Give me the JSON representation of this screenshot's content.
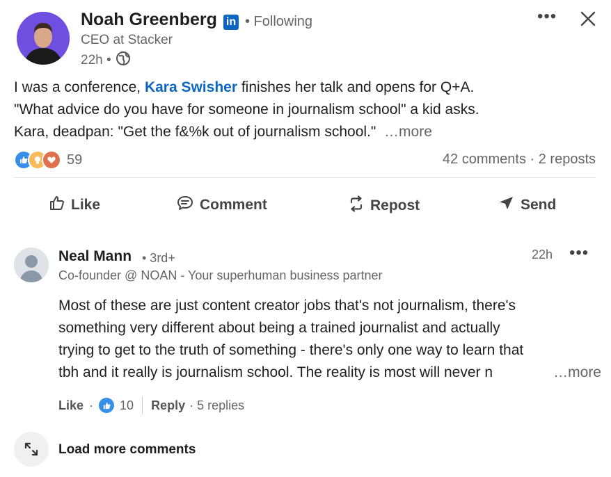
{
  "author": {
    "name": "Noah Greenberg",
    "badge": "in",
    "follow_status": "• Following",
    "headline": "CEO at Stacker",
    "time": "22h •"
  },
  "post": {
    "text_before_mention": "I was a conference, ",
    "mention": "Kara Swisher",
    "text_after_mention": " finishes her talk and opens for Q+A.",
    "line2": "\"What advice do you have for someone in journalism school\" a kid asks.",
    "line3": "Kara, deadpan: \"Get the f&%k out of journalism school.\"",
    "more": "…more"
  },
  "social": {
    "reaction_count": "59",
    "comments_reposts": "42 comments · 2 reposts"
  },
  "actions": {
    "like": "Like",
    "comment": "Comment",
    "repost": "Repost",
    "send": "Send"
  },
  "comment": {
    "name": "Neal Mann",
    "degree": "• 3rd+",
    "time": "22h",
    "headline": "Co-founder @ NOAN - Your superhuman business partner",
    "line1": "Most of these are just content creator jobs that's not journalism, there's",
    "line2": "something very different about being a trained journalist and actually",
    "line3": "trying to get to the truth of something - there's only one way to learn that",
    "line4": "tbh and it really is journalism school. The reality is most will never n",
    "more": "…more",
    "like_label": "Like",
    "like_count": "10",
    "reply_label": "Reply",
    "replies": "· 5 replies"
  },
  "load_more": "Load more comments",
  "colors": {
    "link": "#0a66c2",
    "avatar_bg": "#6f4fe0",
    "muted": "#666666"
  }
}
